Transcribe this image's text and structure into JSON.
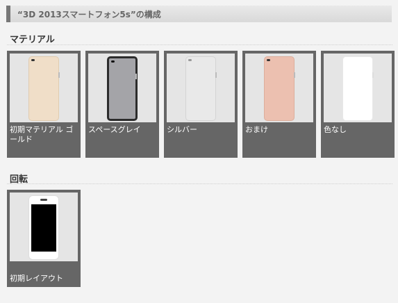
{
  "header": {
    "title": "“3D 2013スマートフォン5s”の構成"
  },
  "materials": {
    "title": "マテリアル",
    "items": [
      {
        "label": "初期マテリアル ゴールド",
        "color": "#f0dec8"
      },
      {
        "label": "スペースグレイ",
        "color": "#a4a4a8"
      },
      {
        "label": "シルバー",
        "color": "#e9e9e9"
      },
      {
        "label": "おまけ",
        "color": "#ecc0b0"
      },
      {
        "label": "色なし",
        "color": "#ffffff"
      }
    ]
  },
  "rotation": {
    "title": "回転",
    "items": [
      {
        "label": "初期レイアウト"
      }
    ]
  }
}
